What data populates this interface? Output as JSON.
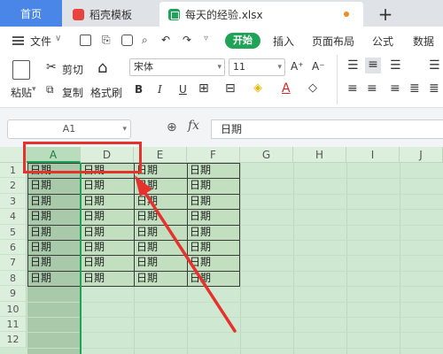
{
  "tabs": {
    "home": "首页",
    "doc": "稻壳模板",
    "file": "每天的经验.xlsx",
    "plus": "+"
  },
  "menu": {
    "file": "文件",
    "start": "开始",
    "insert": "插入",
    "layout": "页面布局",
    "formula": "公式",
    "data": "数据"
  },
  "ribbon": {
    "cut": "剪切",
    "paste": "粘贴",
    "copy": "复制",
    "format_painter": "格式刷",
    "font": "宋体",
    "size": "11",
    "bold": "B",
    "italic": "I",
    "underline": "U"
  },
  "formula_bar": {
    "name_box": "A1",
    "fx": "fx",
    "content": "日期"
  },
  "columns": [
    "A",
    "D",
    "E",
    "F",
    "G",
    "H",
    "I",
    "J"
  ],
  "rows": [
    "1",
    "2",
    "3",
    "4",
    "5",
    "6",
    "7",
    "8",
    "9",
    "10",
    "11",
    "12"
  ],
  "cell_value": "日期",
  "colors": {
    "accent": "#1fa356",
    "highlight": "#e5322d"
  }
}
